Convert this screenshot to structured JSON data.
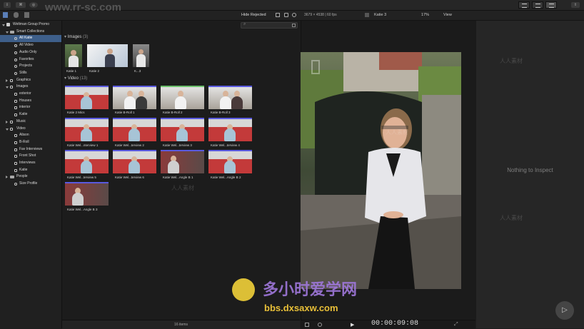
{
  "toolbar": {
    "title_top": "www.rr-sc.com",
    "hide_rejected": "Hide Rejected",
    "format": "3679 × 4538 | 60 fps",
    "clip_name": "Katie 3",
    "zoom": "17%",
    "view": "View"
  },
  "library": {
    "name": "Weltman Group Promo",
    "smart_collections": "Smart Collections",
    "items": [
      "All Katie",
      "All Video",
      "Audio Only",
      "Favorites",
      "Projects",
      "Stills",
      "Graphics",
      "Images",
      "exterior",
      "Houses",
      "interior",
      "Katie",
      "Music",
      "Video",
      "Alison",
      "B-Roll",
      "Fav Interviews",
      "Front Shot",
      "Interviews",
      "Katie",
      "People",
      "Size Profile"
    ]
  },
  "browser": {
    "images_header": "Images",
    "images_count": "(3)",
    "images": [
      "Katie 1",
      "Katie 2",
      "K...3"
    ],
    "video_header": "Video",
    "video_count": "(13)",
    "videos": [
      "Katie 2 Mics",
      "Katie B-Roll 1",
      "Katie B-Roll 2",
      "Katie B-Roll 3",
      "Katie Wel...nterview 1",
      "Katie Wel...terview 2",
      "Katie Wel...terview 3",
      "Katie Wel...terview 4",
      "Katie Wel...terview 5",
      "Katie Wel...terview 6",
      "Katie Wel...Angle B 1",
      "Katie Wel...Angle B 2",
      "Katie Wel...Angle B 3"
    ],
    "footer": "16 items"
  },
  "viewer": {
    "timecode": "00:00:09:08"
  },
  "inspector": {
    "empty": "Nothing to Inspect"
  },
  "watermark": {
    "site": "www.rr-sc.com",
    "brand": "多小时爱学网",
    "url": "bbs.dxsaxw.com",
    "tag": "人人素材"
  }
}
